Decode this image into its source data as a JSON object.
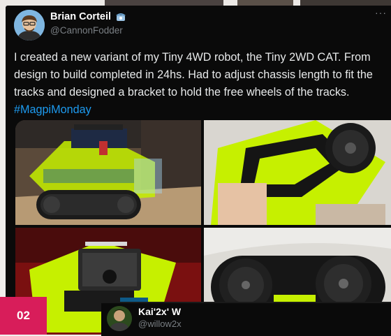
{
  "post": {
    "author_name": "Brian Corteil",
    "author_handle": "@CannonFodder",
    "badge_icon": "telephone-badge-icon",
    "more_icon": "ellipsis-icon",
    "text": "I created a new variant of my Tiny 4WD robot, the Tiny 2WD CAT. From design to build completed in 24hs. Had to adjust chassis length to fit the tracks and designed a bracket to hold the free wheels of the tracks.",
    "hashtag": "#MagpiMonday",
    "photos": [
      {
        "depicts": "Tiny 2WD CAT robot with acrylic chassis and tank tracks"
      },
      {
        "depicts": "Robot underside with black track bracket"
      },
      {
        "depicts": "Close-up of circuit board on green chassis"
      },
      {
        "depicts": "Black track wheels close-up"
      }
    ]
  },
  "figure_label": "02",
  "reply": {
    "author_name": "Kai'2x' W",
    "author_handle": "@willow2x"
  },
  "colors": {
    "card_bg": "#0a0a0a",
    "hashtag": "#1d9bf0",
    "label_bg": "#d81d5a",
    "chassis_green": "#c6f000"
  }
}
